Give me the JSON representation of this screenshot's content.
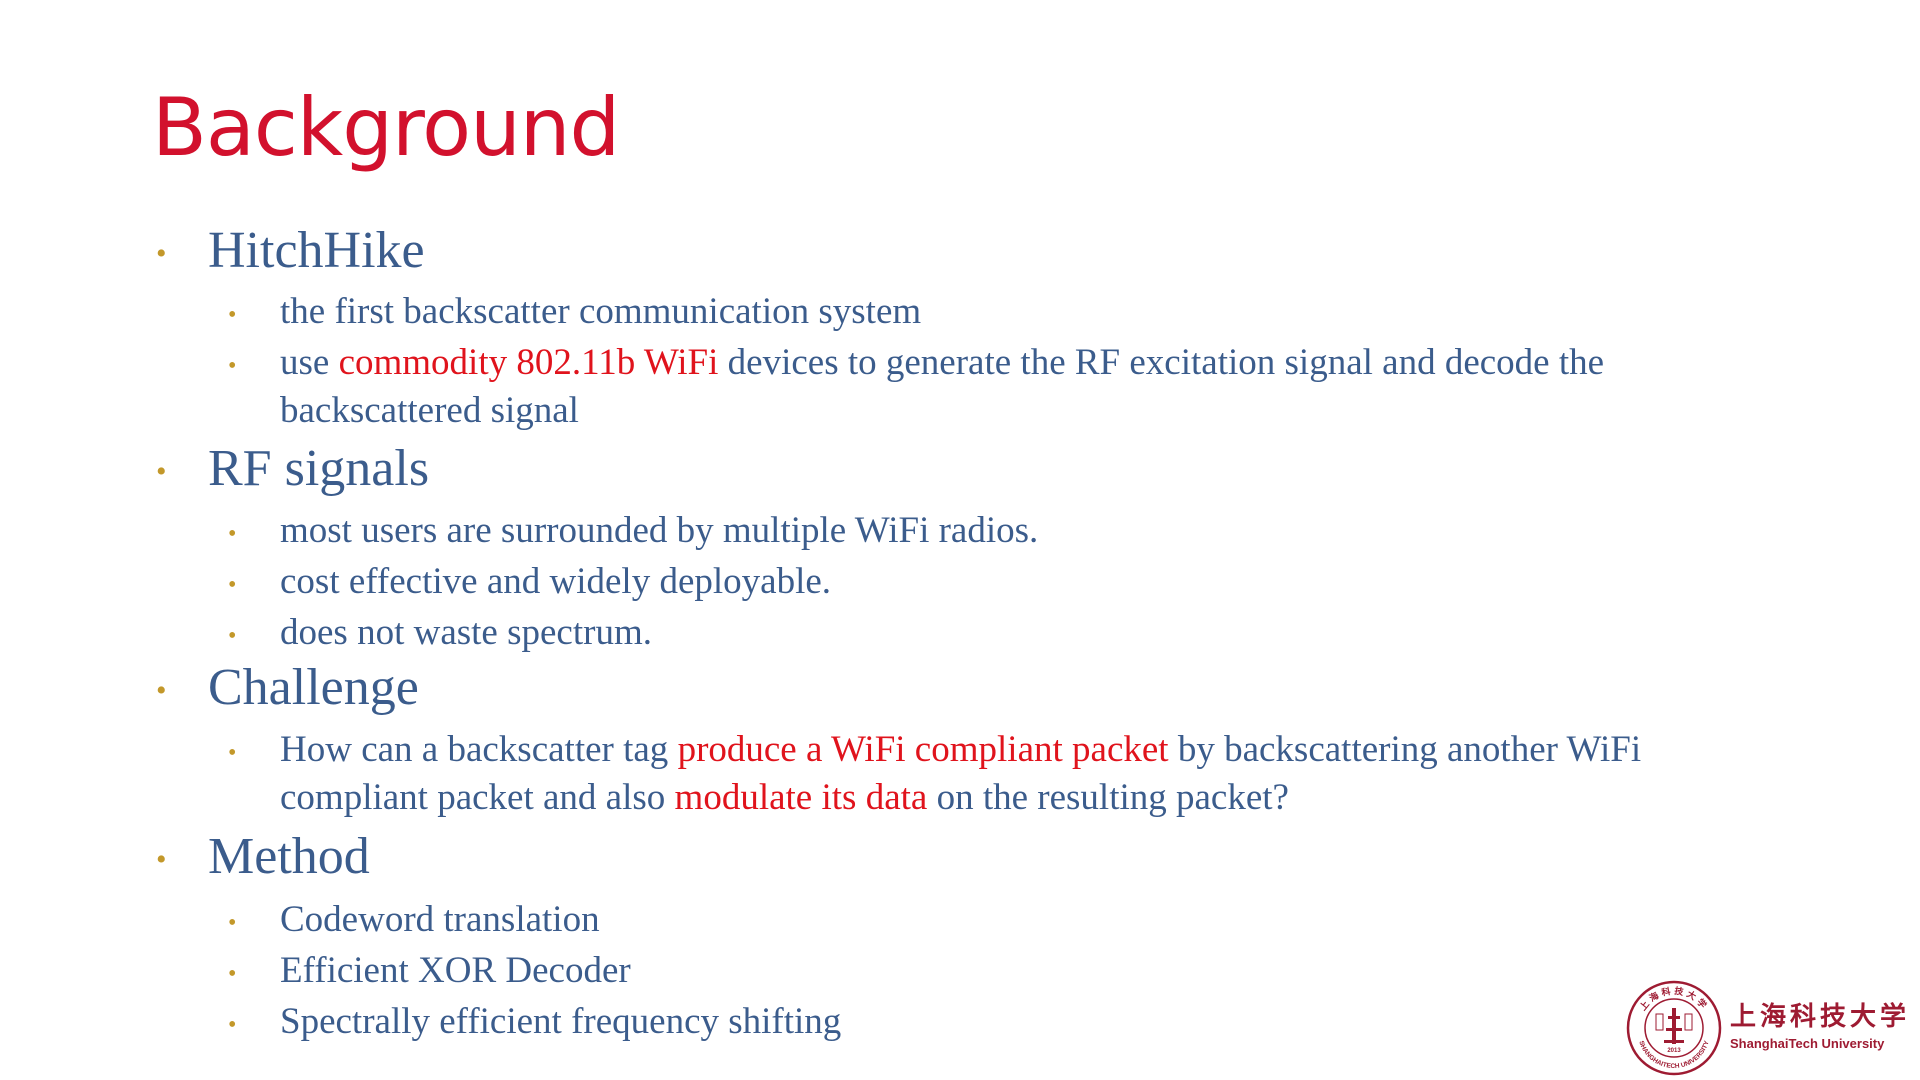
{
  "slide": {
    "title": "Background",
    "sections": [
      {
        "heading": "HitchHike",
        "items": [
          {
            "text": "the first backscatter communication system"
          },
          {
            "prefix": "use ",
            "highlight": "commodity 802.11b WiFi",
            "suffix": " devices to generate the RF excitation signal and decode the backscattered signal"
          }
        ]
      },
      {
        "heading": "RF signals",
        "items": [
          {
            "text": "most users are surrounded by multiple WiFi radios."
          },
          {
            "text": "cost effective and widely deployable."
          },
          {
            "text": "does not waste spectrum."
          }
        ]
      },
      {
        "heading": "Challenge",
        "items": [
          {
            "part1": "How can a backscatter tag ",
            "highlight1": "produce a WiFi compliant packet",
            "part2": " by backscattering another WiFi compliant packet and also ",
            "highlight2": "modulate its data",
            "part3": " on the resulting packet?"
          }
        ]
      },
      {
        "heading": "Method",
        "items": [
          {
            "text": "Codeword translation"
          },
          {
            "text": "Efficient XOR Decoder"
          },
          {
            "text": "Spectrally efficient frequency shifting"
          }
        ]
      }
    ],
    "bullet_char": "•"
  },
  "logo": {
    "chinese_name": "上海科技大学",
    "english_name": "ShanghaiTech University",
    "seal_ring_text": "SHANGHAITECH UNIVERSITY",
    "seal_year": "2013"
  },
  "colors": {
    "title": "#d2112d",
    "body": "#3b5c8c",
    "highlight": "#e0131c",
    "bullet": "#c3982a",
    "logo": "#9e1b32"
  }
}
